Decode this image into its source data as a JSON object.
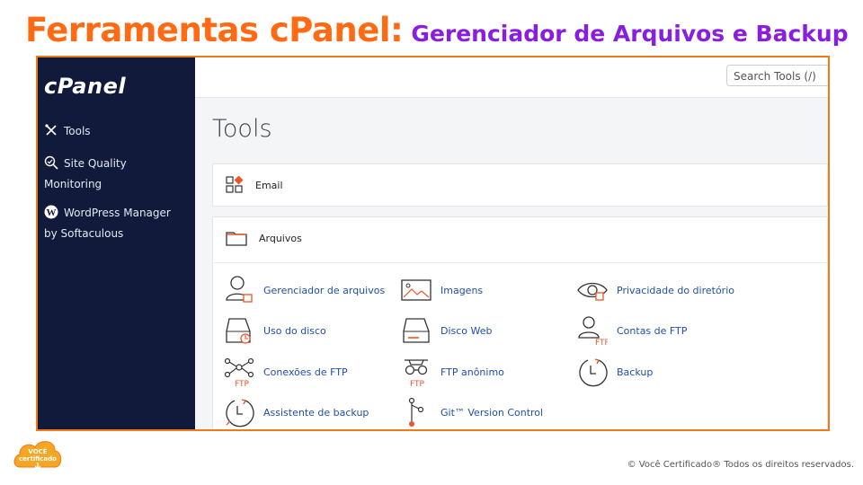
{
  "slide": {
    "title_main": "Ferramentas cPanel:",
    "title_sub": "Gerenciador de Arquivos e Backup",
    "copyright": "© Você Certificado® Todos os direitos reservados.",
    "badge_line1": "VOCÊ",
    "badge_line2": "certificado"
  },
  "sidebar": {
    "logo": "cPanel",
    "items": [
      {
        "label1": "Tools",
        "label2": "",
        "icon": "tools-icon"
      },
      {
        "label1": "Site Quality",
        "label2": "Monitoring",
        "icon": "magnifier-icon"
      },
      {
        "label1": "WordPress Manager",
        "label2": "by Softaculous",
        "icon": "wordpress-icon"
      }
    ]
  },
  "header": {
    "search_placeholder": "Search Tools (/)"
  },
  "main": {
    "title": "Tools",
    "email_label": "Email",
    "arquivos_label": "Arquivos",
    "tools": [
      {
        "label": "Gerenciador de arquivos",
        "icon": "file-manager-icon"
      },
      {
        "label": "Imagens",
        "icon": "images-icon"
      },
      {
        "label": "Privacidade do diretório",
        "icon": "directory-privacy-icon"
      },
      {
        "label": "Uso do disco",
        "icon": "disk-usage-icon"
      },
      {
        "label": "Disco Web",
        "icon": "web-disk-icon"
      },
      {
        "label": "Contas de FTP",
        "icon": "ftp-accounts-icon"
      },
      {
        "label": "Conexões de FTP",
        "icon": "ftp-connections-icon"
      },
      {
        "label": "FTP anônimo",
        "icon": "anonymous-ftp-icon"
      },
      {
        "label": "Backup",
        "icon": "backup-icon"
      },
      {
        "label": "Assistente de backup",
        "icon": "backup-wizard-icon"
      },
      {
        "label": "Git™ Version Control",
        "icon": "git-icon"
      }
    ],
    "ftp_tag": "FTP"
  },
  "colors": {
    "accent": "#ff6a13",
    "purple": "#8a1ee0",
    "sidebar": "#111a3b",
    "link": "#1f4fa8"
  }
}
